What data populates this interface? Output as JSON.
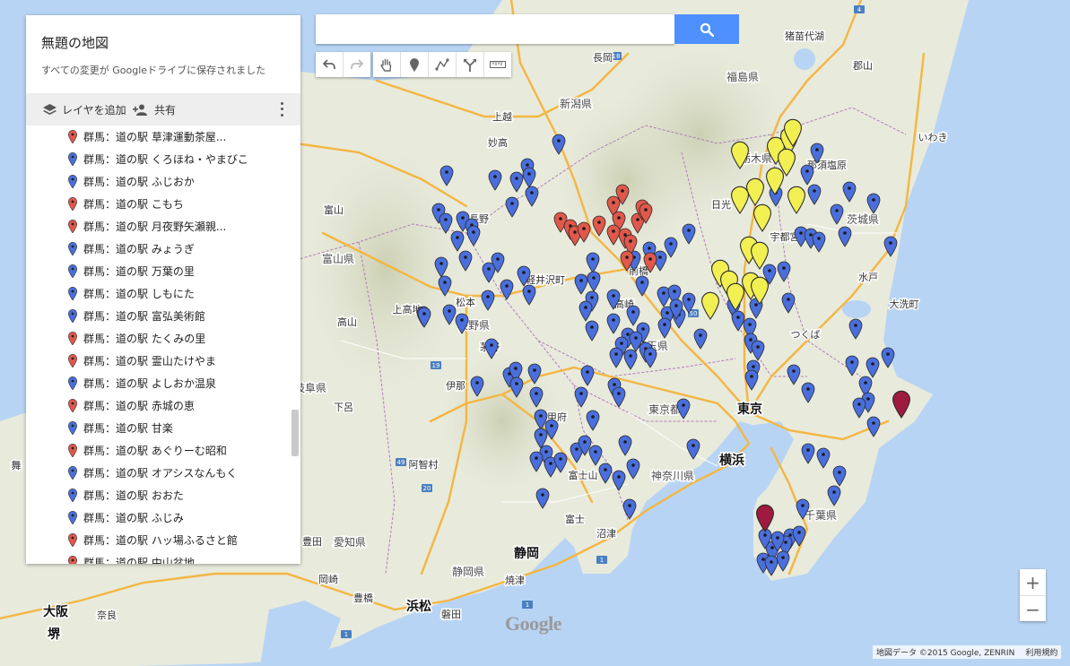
{
  "map_title": "無題の地図",
  "save_status": "すべての変更が Googleドライブに保存されました",
  "actions": {
    "add_layer": "レイヤを追加",
    "share": "共有"
  },
  "colors": {
    "blue": "#4a6fdc",
    "red": "#e0584b",
    "yellow": "#f2ef52",
    "maroon": "#9e1a3f"
  },
  "list_items": [
    {
      "label": "群馬：道の駅  草津運動茶屋...",
      "color": "red"
    },
    {
      "label": "群馬：道の駅  くろほね・やまびこ",
      "color": "blue"
    },
    {
      "label": "群馬：道の駅  ふじおか",
      "color": "blue"
    },
    {
      "label": "群馬：道の駅  こもち",
      "color": "red"
    },
    {
      "label": "群馬：道の駅  月夜野矢瀬親...",
      "color": "red"
    },
    {
      "label": "群馬：道の駅  みょうぎ",
      "color": "blue"
    },
    {
      "label": "群馬：道の駅  万葉の里",
      "color": "blue"
    },
    {
      "label": "群馬：道の駅  しもにた",
      "color": "blue"
    },
    {
      "label": "群馬：道の駅  富弘美術館",
      "color": "blue"
    },
    {
      "label": "群馬：道の駅  たくみの里",
      "color": "red"
    },
    {
      "label": "群馬：道の駅  霊山たけやま",
      "color": "red"
    },
    {
      "label": "群馬：道の駅  よしおか温泉",
      "color": "blue"
    },
    {
      "label": "群馬：道の駅  赤城の恵",
      "color": "red"
    },
    {
      "label": "群馬：道の駅  甘楽",
      "color": "blue"
    },
    {
      "label": "群馬：道の駅  あぐりーむ昭和",
      "color": "red"
    },
    {
      "label": "群馬：道の駅  オアシスなんもく",
      "color": "blue"
    },
    {
      "label": "群馬：道の駅  おおた",
      "color": "blue"
    },
    {
      "label": "群馬：道の駅  ふじみ",
      "color": "blue"
    },
    {
      "label": "群馬：道の駅  ハッ場ふるさと館",
      "color": "red"
    },
    {
      "label": "群馬：道の駅  中山盆地",
      "color": "red"
    }
  ],
  "map_labels": [
    {
      "text": "長岡",
      "cls": "city"
    },
    {
      "text": "新潟県",
      "cls": "pref"
    },
    {
      "text": "福島県",
      "cls": "pref"
    },
    {
      "text": "郡山",
      "cls": "city"
    },
    {
      "text": "猪苗代湖",
      "cls": "city"
    },
    {
      "text": "いわき",
      "cls": "city"
    },
    {
      "text": "上越",
      "cls": "city"
    },
    {
      "text": "妙高",
      "cls": "city"
    },
    {
      "text": "那須塩原",
      "cls": "city"
    },
    {
      "text": "栃木県",
      "cls": "pref"
    },
    {
      "text": "日光",
      "cls": "city"
    },
    {
      "text": "長野",
      "cls": "city"
    },
    {
      "text": "富山",
      "cls": "city"
    },
    {
      "text": "宇都宮",
      "cls": "city"
    },
    {
      "text": "茨城県",
      "cls": "pref"
    },
    {
      "text": "富山県",
      "cls": "pref"
    },
    {
      "text": "軽井沢町",
      "cls": "city"
    },
    {
      "text": "前橋",
      "cls": "city"
    },
    {
      "text": "水戸",
      "cls": "city"
    },
    {
      "text": "松本",
      "cls": "city"
    },
    {
      "text": "高崎",
      "cls": "city"
    },
    {
      "text": "大洗町",
      "cls": "city"
    },
    {
      "text": "高山",
      "cls": "city"
    },
    {
      "text": "長野県",
      "cls": "pref"
    },
    {
      "text": "上高地",
      "cls": "city"
    },
    {
      "text": "つくば",
      "cls": "city"
    },
    {
      "text": "茅野",
      "cls": "city"
    },
    {
      "text": "埼玉県",
      "cls": "pref"
    },
    {
      "text": "岐阜県",
      "cls": "pref"
    },
    {
      "text": "伊那",
      "cls": "city"
    },
    {
      "text": "下呂",
      "cls": "city"
    },
    {
      "text": "東京都",
      "cls": "pref"
    },
    {
      "text": "甲府",
      "cls": "city"
    },
    {
      "text": "東京",
      "cls": "bigcity"
    },
    {
      "text": "阿智村",
      "cls": "city"
    },
    {
      "text": "横浜",
      "cls": "bigcity"
    },
    {
      "text": "神奈川県",
      "cls": "pref"
    },
    {
      "text": "富士山",
      "cls": "city"
    },
    {
      "text": "千葉県",
      "cls": "pref"
    },
    {
      "text": "富士",
      "cls": "city"
    },
    {
      "text": "豊田",
      "cls": "city"
    },
    {
      "text": "愛知県",
      "cls": "pref"
    },
    {
      "text": "静岡",
      "cls": "bigcity"
    },
    {
      "text": "沼津",
      "cls": "city"
    },
    {
      "text": "静岡県",
      "cls": "pref"
    },
    {
      "text": "焼津",
      "cls": "city"
    },
    {
      "text": "岡崎",
      "cls": "city"
    },
    {
      "text": "豊橋",
      "cls": "city"
    },
    {
      "text": "浜松",
      "cls": "bigcity"
    },
    {
      "text": "磐田",
      "cls": "city"
    },
    {
      "text": "大阪",
      "cls": "bigcity"
    },
    {
      "text": "奈良",
      "cls": "city"
    },
    {
      "text": "堺",
      "cls": "bigcity"
    },
    {
      "text": "舞",
      "cls": "city"
    }
  ],
  "route_shields": [
    "49",
    "19",
    "18",
    "20",
    "50",
    "4",
    "1",
    "1",
    "1"
  ],
  "map_pins": {
    "blue": 110,
    "red": 16,
    "yellow": 18,
    "maroon": 2
  },
  "google_logo": "Google",
  "attribution": "地図データ ©2015 Google, ZENRIN",
  "terms": "利用規約",
  "zoom_in": "+",
  "zoom_out": "−"
}
